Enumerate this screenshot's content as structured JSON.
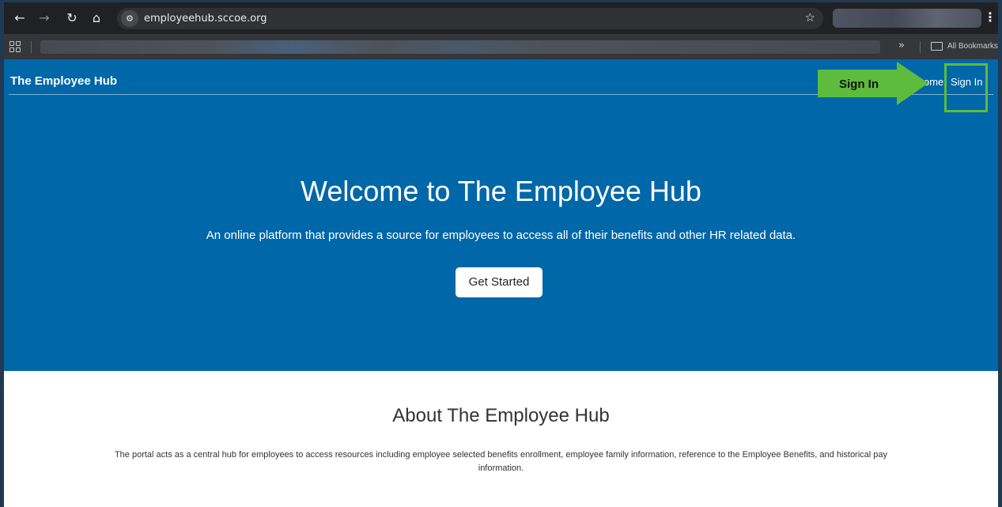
{
  "browser": {
    "url": "employeehub.sccoe.org",
    "bookmarks_overflow": "»",
    "all_bookmarks_label": "All Bookmarks"
  },
  "site": {
    "brand": "The Employee Hub",
    "nav": {
      "home_partial": "ome",
      "sign_in": "Sign In"
    },
    "hero": {
      "title": "Welcome to The Employee Hub",
      "subtitle": "An online platform that provides a source for employees to access all of their benefits and other HR related data.",
      "button": "Get Started"
    },
    "about": {
      "title": "About The Employee Hub",
      "text": "The portal acts as a central hub for employees to access resources including employee selected benefits enrollment, employee family information, reference to the Employee Benefits, and historical pay information."
    }
  },
  "annotation": {
    "arrow_label": "Sign In",
    "highlight_color": "#5dbb3d"
  },
  "colors": {
    "brand_blue": "#0067a8",
    "browser_dark": "#202124"
  }
}
